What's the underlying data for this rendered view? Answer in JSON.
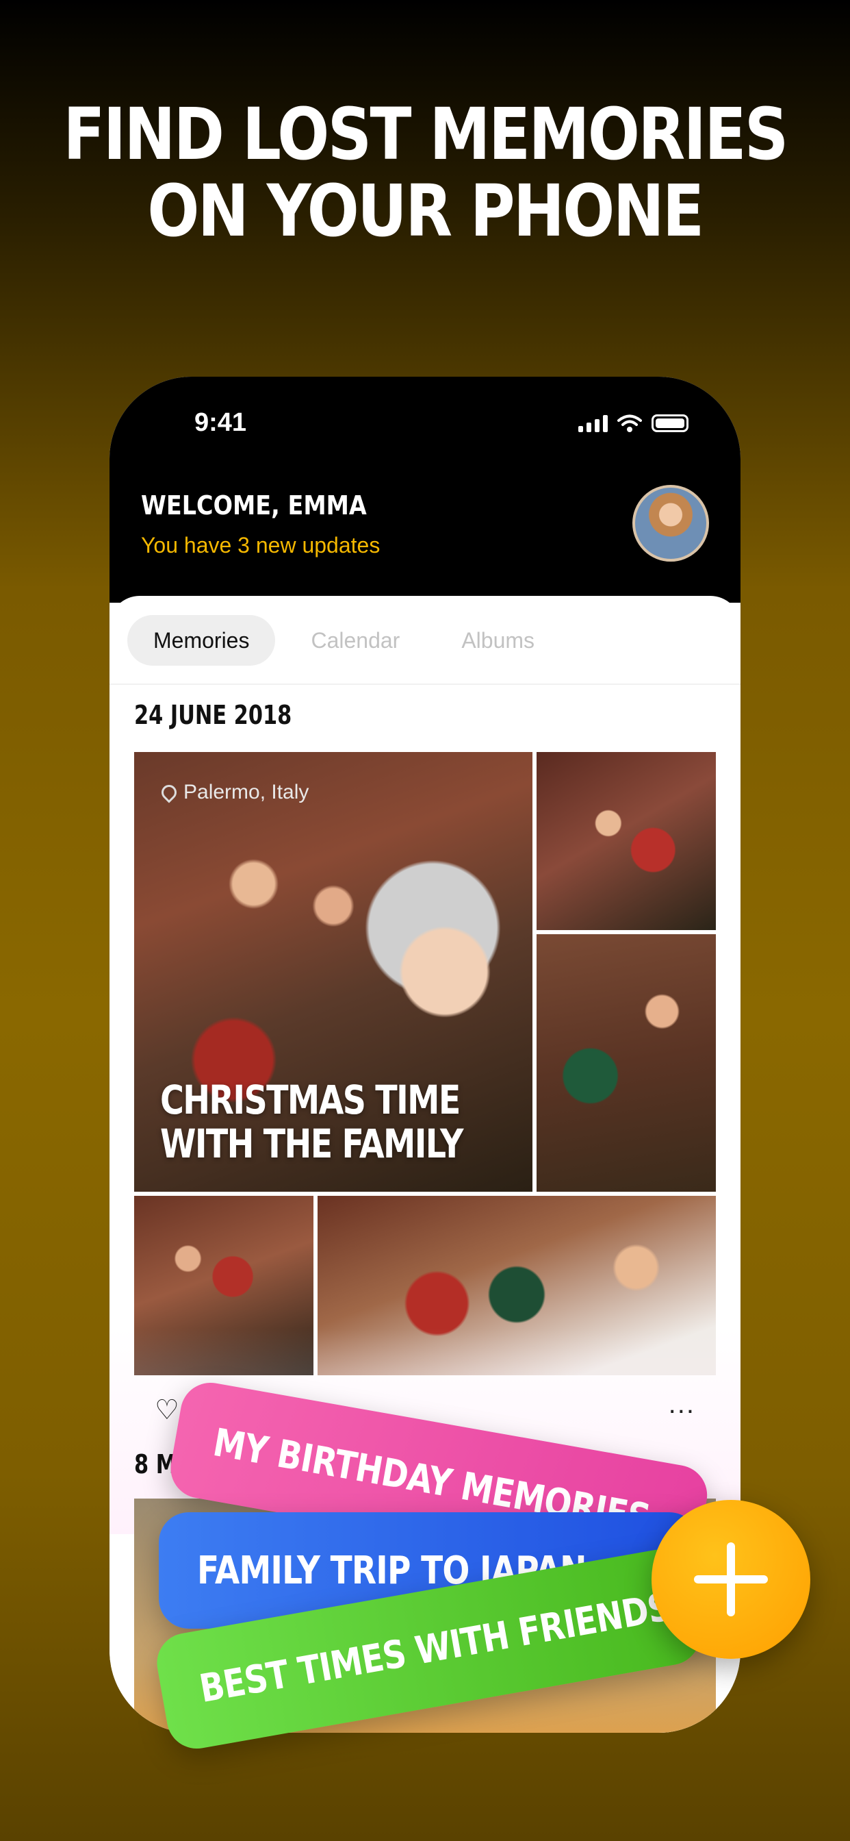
{
  "headline": {
    "line1": "FIND LOST MEMORIES",
    "line2": "ON YOUR PHONE"
  },
  "status_bar": {
    "time": "9:41"
  },
  "header": {
    "welcome": "WELCOME, EMMA",
    "updates": "You have 3 new updates"
  },
  "tabs": [
    {
      "label": "Memories",
      "active": true
    },
    {
      "label": "Calendar",
      "active": false
    },
    {
      "label": "Albums",
      "active": false
    }
  ],
  "memory": {
    "date": "24 JUNE 2018",
    "location": "Palermo, Italy",
    "caption_line1": "CHRISTMAS TIME",
    "caption_line2": "WITH THE FAMILY"
  },
  "next_date": "8 M",
  "actions": {
    "more": "..."
  },
  "albums": [
    {
      "label": "MY BIRTHDAY MEMORIES",
      "color": "#f255ac"
    },
    {
      "label": "FAMILY TRIP TO JAPAN",
      "color": "#2f66ea"
    },
    {
      "label": "BEST TIMES WITH FRIENDS",
      "color": "#5fcc32"
    }
  ],
  "colors": {
    "accent": "#f5b800",
    "fab": "#ffb000"
  }
}
